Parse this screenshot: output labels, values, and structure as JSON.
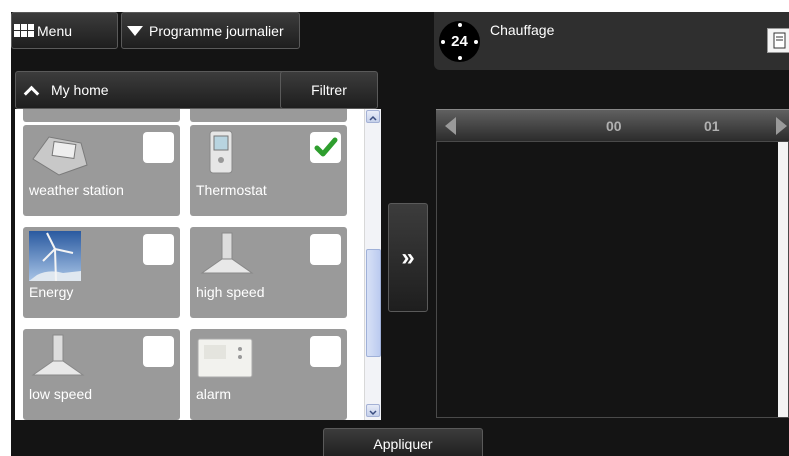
{
  "toolbar": {
    "menu_label": "Menu",
    "program_label": "Programme journalier"
  },
  "device_list": {
    "group_label": "My home",
    "filter_label": "Filtrer",
    "devices": [
      {
        "name": "weather station",
        "checked": false,
        "icon": "weather-station-icon"
      },
      {
        "name": "Thermostat",
        "checked": true,
        "icon": "thermostat-icon"
      },
      {
        "name": "Energy",
        "checked": false,
        "icon": "wind-turbine-icon"
      },
      {
        "name": "high speed",
        "checked": false,
        "icon": "range-hood-icon"
      },
      {
        "name": "low speed",
        "checked": false,
        "icon": "range-hood-icon"
      },
      {
        "name": "alarm",
        "checked": false,
        "icon": "alarm-panel-icon"
      }
    ]
  },
  "transfer_label": "»",
  "apply_label": "Appliquer",
  "heating": {
    "clock_value": "24",
    "title": "Chauffage"
  },
  "timeline": {
    "hours": [
      "00",
      "01"
    ]
  },
  "colors": {
    "checkmark": "#2e9e2e",
    "tile": "#9a9a9a",
    "background": "#141414"
  }
}
